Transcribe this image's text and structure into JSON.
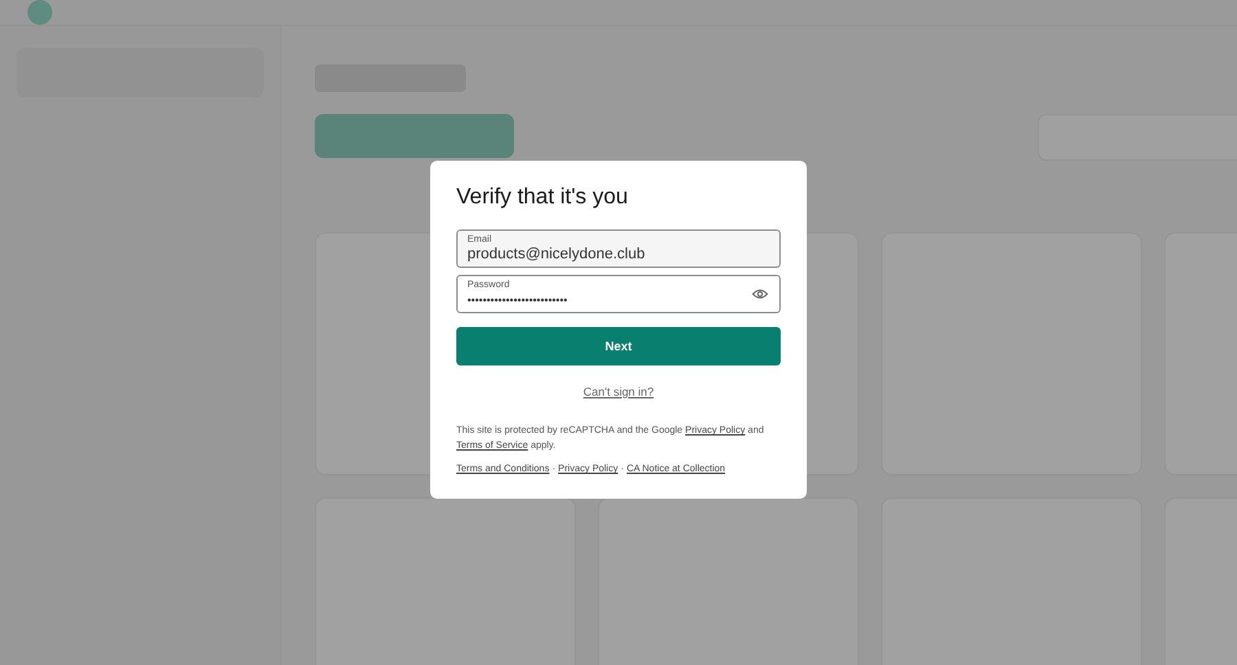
{
  "dialog": {
    "title": "Verify that it's you",
    "fields": [
      {
        "kind": "text",
        "label": "Email",
        "value": "products@nicelydone.club"
      },
      {
        "kind": "password",
        "label": "Password",
        "value": "••••••••••••••••••••••••••"
      }
    ],
    "submit": "Next",
    "help_link": "Can't sign in?",
    "notice": {
      "before": "This site is protected by reCAPTCHA and the Google",
      "privacy": "Privacy Policy",
      "and": "and",
      "terms": "Terms of Service",
      "after": "apply."
    },
    "footer_links": [
      "Terms and Conditions",
      "Privacy Policy",
      "CA Notice at Collection"
    ],
    "footer_separator": "·"
  }
}
